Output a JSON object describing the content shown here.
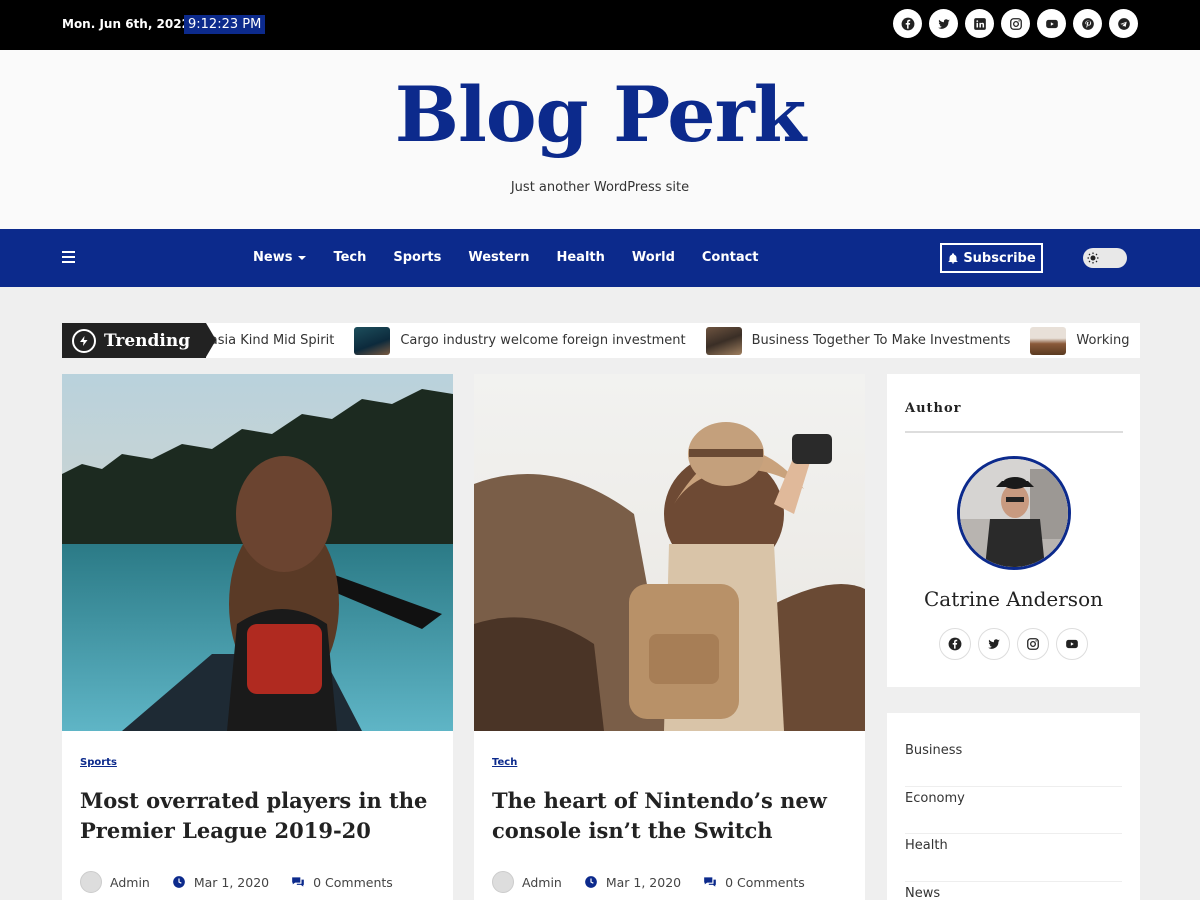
{
  "topbar": {
    "date": "Mon. Jun 6th, 2022",
    "time": "9:12:23 PM",
    "social": [
      "facebook-icon",
      "twitter-icon",
      "linkedin-icon",
      "instagram-icon",
      "youtube-icon",
      "pinterest-icon",
      "telegram-icon"
    ]
  },
  "header": {
    "title": "Blog Perk",
    "tagline": "Just another WordPress site"
  },
  "nav": {
    "items": [
      "News",
      "Tech",
      "Sports",
      "Western",
      "Health",
      "World",
      "Contact"
    ],
    "subscribe": "Subscribe"
  },
  "trending": {
    "label": "Trending",
    "items": [
      "l asia Kind Mid Spirit",
      "Cargo industry welcome foreign investment",
      "Business Together To Make Investments",
      "Working"
    ]
  },
  "posts": [
    {
      "category": "Sports",
      "title": "Most overrated players in the Premier League 2019-20",
      "author": "Admin",
      "date": "Mar 1, 2020",
      "comments": "0 Comments"
    },
    {
      "category": "Tech",
      "title": "The heart of Nintendo’s new console isn’t the Switch",
      "author": "Admin",
      "date": "Mar 1, 2020",
      "comments": "0 Comments"
    }
  ],
  "sidebar": {
    "author_title": "Author",
    "author_name": "Catrine Anderson",
    "categories": [
      "Business",
      "Economy",
      "Health",
      "News"
    ]
  },
  "colors": {
    "brand": "#0c2a8c",
    "topbar": "#000000"
  }
}
